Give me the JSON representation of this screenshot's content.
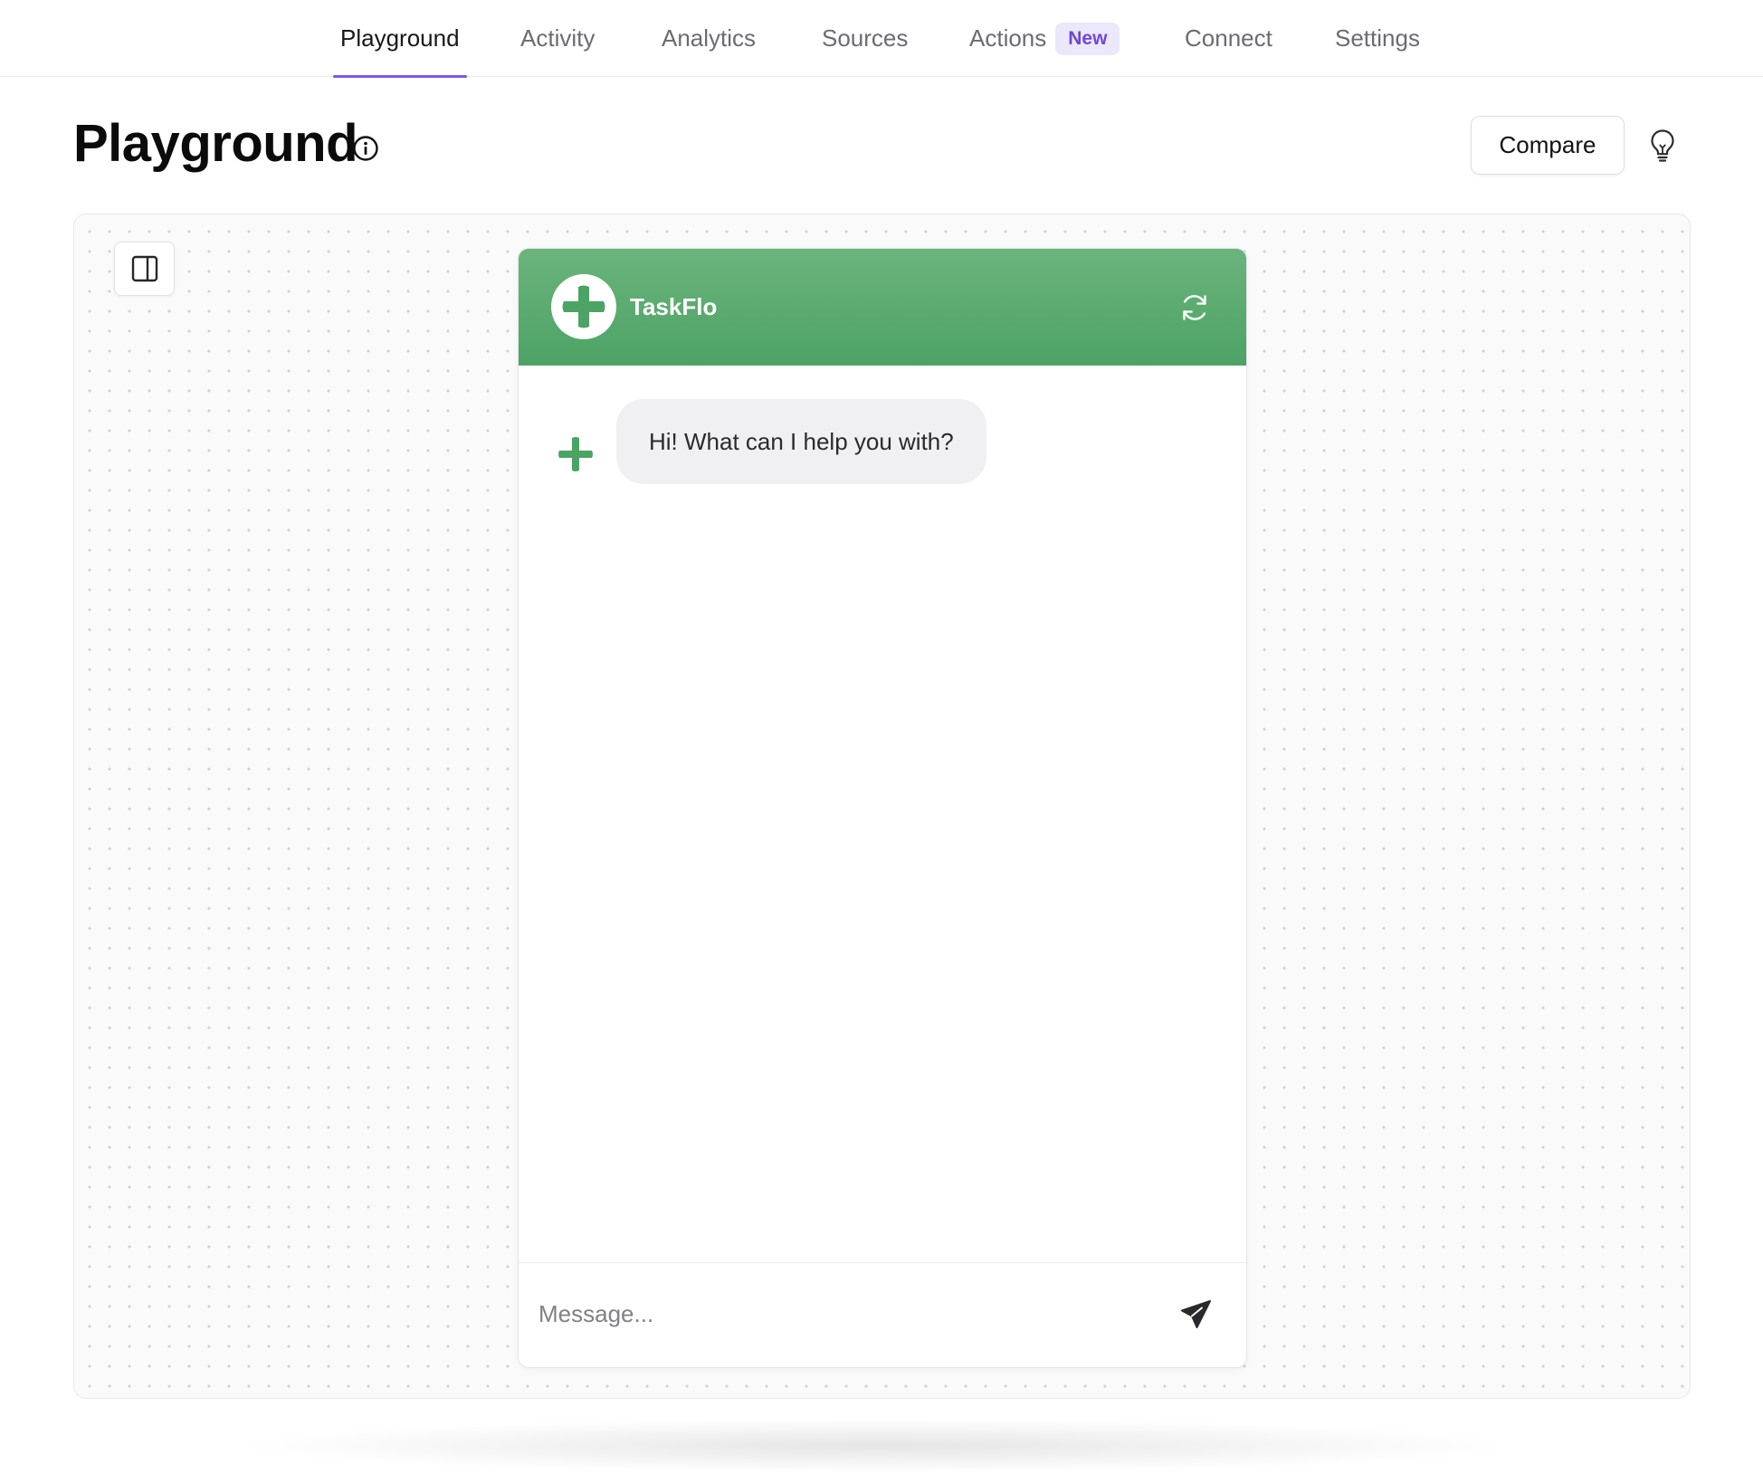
{
  "nav": {
    "tabs": [
      {
        "label": "Playground",
        "active": true
      },
      {
        "label": "Activity",
        "active": false
      },
      {
        "label": "Analytics",
        "active": false
      },
      {
        "label": "Sources",
        "active": false
      },
      {
        "label": "Actions",
        "active": false,
        "badge": "New"
      },
      {
        "label": "Connect",
        "active": false
      },
      {
        "label": "Settings",
        "active": false
      }
    ]
  },
  "header": {
    "title": "Playground",
    "info_icon": "info-icon",
    "compare_label": "Compare",
    "tips_icon": "lightbulb-icon"
  },
  "canvas": {
    "toggle_icon": "sidebar-panel-icon"
  },
  "chat": {
    "bot_name": "TaskFlo",
    "logo_icon": "green-cross-logo",
    "refresh_icon": "refresh-icon",
    "messages": [
      {
        "from": "bot",
        "text": "Hi! What can I help you with?"
      }
    ],
    "input_placeholder": "Message...",
    "send_icon": "send-icon"
  },
  "colors": {
    "accent": "#7c5cd6",
    "badge_bg": "#ece7fb",
    "badge_text": "#6d48d8",
    "brand_green": "#4da265",
    "brand_green_light": "#6bb47d"
  }
}
